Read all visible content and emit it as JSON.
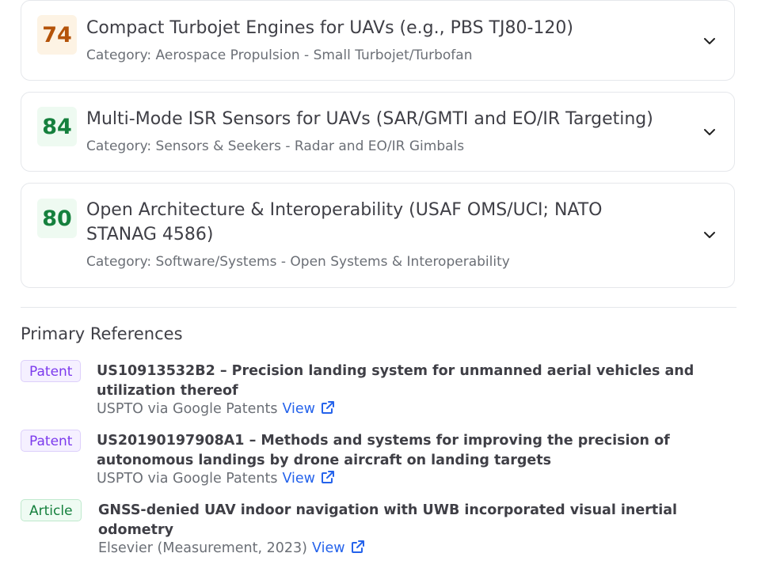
{
  "cards": [
    {
      "score": "74",
      "title": "Compact Turbojet Engines for UAVs (e.g., PBS TJ80-120)",
      "subtitle": "Category: Aerospace Propulsion - Small Turbojet/Turbofan",
      "score_color": "#b45309"
    },
    {
      "score": "84",
      "title": "Multi-Mode ISR Sensors for UAVs (SAR/GMTI and EO/IR Targeting)",
      "subtitle": "Category: Sensors & Seekers - Radar and EO/IR Gimbals",
      "score_color": "#15803d"
    },
    {
      "score": "80",
      "title_line1": "Open Architecture & Interoperability (USAF OMS/UCI; NATO",
      "title_line2": "STANAG 4586)",
      "subtitle": "Category: Software/Systems - Open Systems & Interoperability",
      "score_color": "#15803d"
    }
  ],
  "references": {
    "heading": "Primary References",
    "items": [
      {
        "tag": "Patent",
        "title": "US10913532B2 – Precision landing system for unmanned aerial vehicles and utilization thereof",
        "source": "USPTO via Google Patents",
        "link_label": "View"
      },
      {
        "tag": "Patent",
        "title": "US20190197908A1 – Methods and systems for improving the precision of autonomous landings by drone aircraft on landing targets",
        "source": "USPTO via Google Patents",
        "link_label": "View"
      },
      {
        "tag": "Article",
        "title": "GNSS-denied UAV indoor navigation with UWB incorporated visual inertial odometry",
        "source": "Elsevier (Measurement, 2023)",
        "link_label": "View"
      }
    ]
  },
  "icons": {
    "expand": "chevron-down-icon",
    "external": "external-link-icon"
  },
  "colors": {
    "link": "#2563eb",
    "patent_tag": "#7c3aed",
    "article_tag": "#15803d"
  }
}
